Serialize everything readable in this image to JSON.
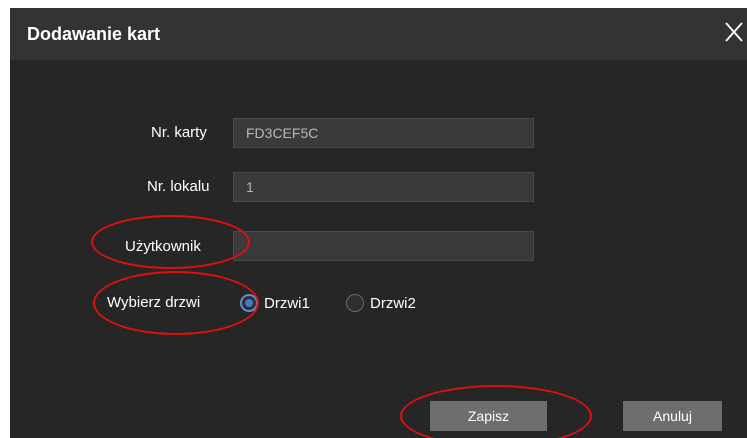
{
  "dialog": {
    "title": "Dodawanie kart",
    "close_icon": "close-icon"
  },
  "form": {
    "card_number": {
      "label": "Nr. karty",
      "value": "FD3CEF5C"
    },
    "unit_number": {
      "label": "Nr. lokalu",
      "value": "1"
    },
    "user": {
      "label": "Użytkownik",
      "value": ""
    },
    "door": {
      "label": "Wybierz drzwi",
      "options": [
        "Drzwi1",
        "Drzwi2"
      ],
      "selected": "Drzwi1"
    }
  },
  "buttons": {
    "save": "Zapisz",
    "cancel": "Anuluj"
  },
  "colors": {
    "dialog_bg": "#262626",
    "titlebar_bg": "#333333",
    "field_bg": "#3a3a3a",
    "button_bg": "#6e6e6e",
    "radio_accent": "#3a7bd5",
    "annotation": "#e01010"
  }
}
